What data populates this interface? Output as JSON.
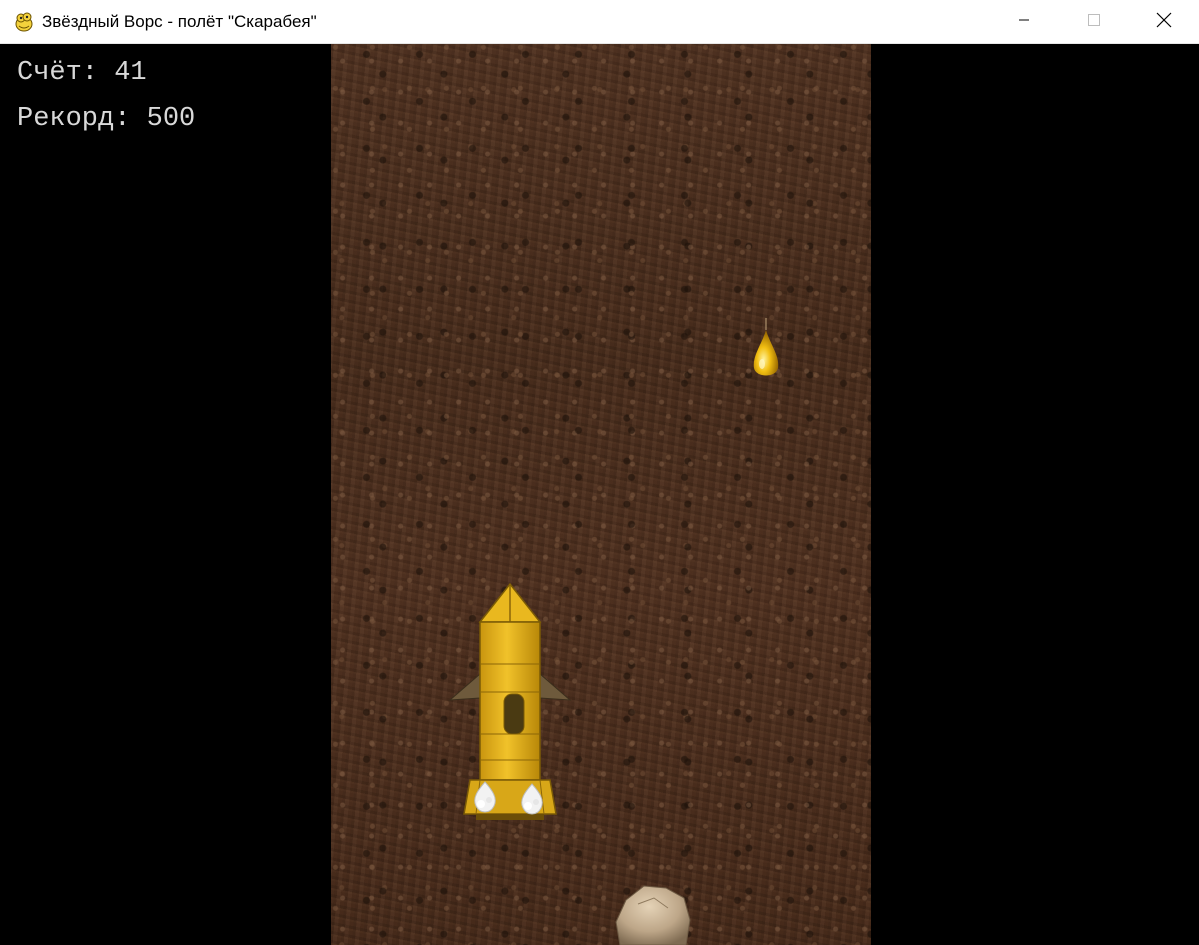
{
  "window": {
    "title": "Звёздный Ворс - полёт \"Скарабея\""
  },
  "controls": {
    "minimize_icon": "minimize-icon",
    "maximize_icon": "maximize-icon",
    "close_icon": "close-icon"
  },
  "hud": {
    "score_label": "Счёт:",
    "score_value": "41",
    "record_label": "Рекорд:",
    "record_value": "500"
  },
  "scene": {
    "background": "dirt-texture",
    "player": "rocket-ship",
    "pickup": "golden-drop",
    "obstacle": "rock",
    "colors": {
      "ship_body": "#e3b21f",
      "ship_shadow": "#a77d0c",
      "dirt": "#4b2e1d",
      "hud_text": "#d9d9d9"
    }
  }
}
